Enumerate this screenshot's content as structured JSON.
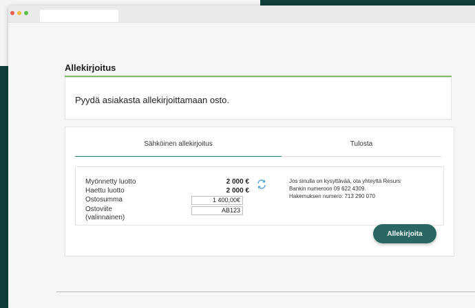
{
  "section": {
    "title": "Allekirjoitus",
    "instruction": "Pyydä asiakasta allekirjoittamaan osto."
  },
  "tabs": [
    {
      "label": "Sähköinen allekirjoitus",
      "active": true
    },
    {
      "label": "Tulosta",
      "active": false
    }
  ],
  "details": {
    "granted_credit_label": "Myönnetty luotto",
    "granted_credit_value": "2 000 €",
    "requested_credit_label": "Haettu luotto",
    "requested_credit_value": "2 000 €",
    "purchase_amount_label": "Ostosumma",
    "purchase_amount_value": "1 400,00€",
    "purchase_reference_label_1": "Ostoviite",
    "purchase_reference_label_2": "(valinnainen)",
    "purchase_reference_value": "AB123"
  },
  "help": {
    "line1": "Jos sinulla on kysyttävää, ota yhteyttä Resurs",
    "line2": "Bankin numeroon 09 622 4309.",
    "line3": "Hakemuksen numero: 713 290 070"
  },
  "actions": {
    "sign_label": "Allekirjoita"
  },
  "colors": {
    "brand_dark": "#2a6762",
    "accent_green": "#7cbf63",
    "background_dark": "#0f3f38"
  }
}
